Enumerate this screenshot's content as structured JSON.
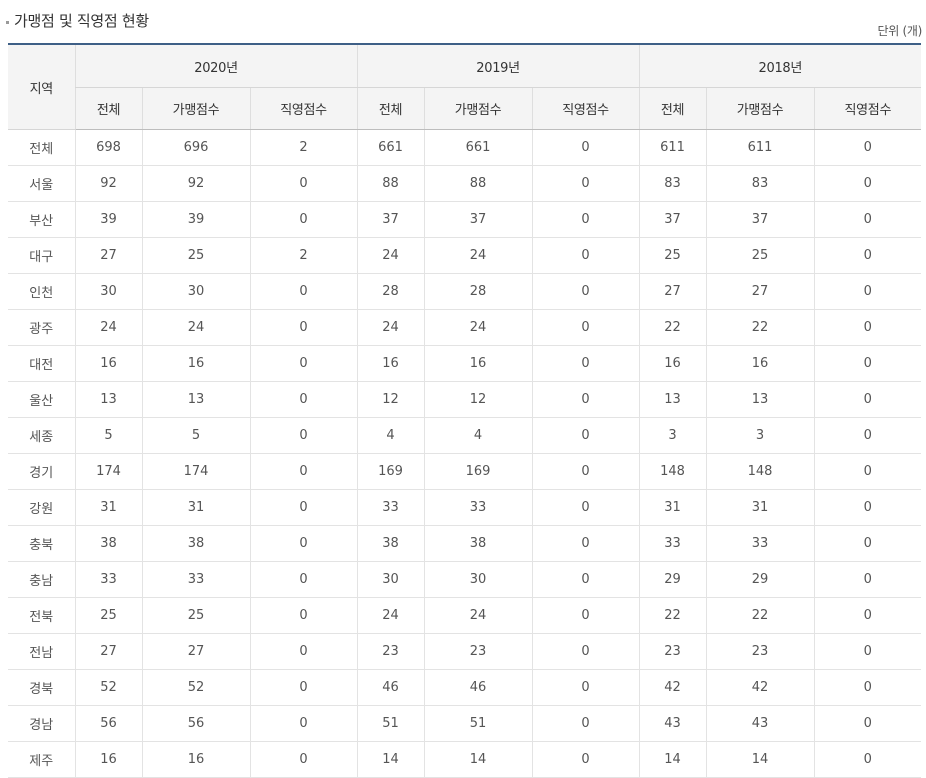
{
  "title": "가맹점 및 직영점 현황",
  "unit": "단위 (개)",
  "header": {
    "region": "지역",
    "years": [
      "2020년",
      "2019년",
      "2018년"
    ],
    "subcols": [
      "전체",
      "가맹점수",
      "직영점수"
    ]
  },
  "rows": [
    {
      "region": "전체",
      "values": [
        "698",
        "696",
        "2",
        "661",
        "661",
        "0",
        "611",
        "611",
        "0"
      ]
    },
    {
      "region": "서울",
      "values": [
        "92",
        "92",
        "0",
        "88",
        "88",
        "0",
        "83",
        "83",
        "0"
      ]
    },
    {
      "region": "부산",
      "values": [
        "39",
        "39",
        "0",
        "37",
        "37",
        "0",
        "37",
        "37",
        "0"
      ]
    },
    {
      "region": "대구",
      "values": [
        "27",
        "25",
        "2",
        "24",
        "24",
        "0",
        "25",
        "25",
        "0"
      ]
    },
    {
      "region": "인천",
      "values": [
        "30",
        "30",
        "0",
        "28",
        "28",
        "0",
        "27",
        "27",
        "0"
      ]
    },
    {
      "region": "광주",
      "values": [
        "24",
        "24",
        "0",
        "24",
        "24",
        "0",
        "22",
        "22",
        "0"
      ]
    },
    {
      "region": "대전",
      "values": [
        "16",
        "16",
        "0",
        "16",
        "16",
        "0",
        "16",
        "16",
        "0"
      ]
    },
    {
      "region": "울산",
      "values": [
        "13",
        "13",
        "0",
        "12",
        "12",
        "0",
        "13",
        "13",
        "0"
      ]
    },
    {
      "region": "세종",
      "values": [
        "5",
        "5",
        "0",
        "4",
        "4",
        "0",
        "3",
        "3",
        "0"
      ]
    },
    {
      "region": "경기",
      "values": [
        "174",
        "174",
        "0",
        "169",
        "169",
        "0",
        "148",
        "148",
        "0"
      ]
    },
    {
      "region": "강원",
      "values": [
        "31",
        "31",
        "0",
        "33",
        "33",
        "0",
        "31",
        "31",
        "0"
      ]
    },
    {
      "region": "충북",
      "values": [
        "38",
        "38",
        "0",
        "38",
        "38",
        "0",
        "33",
        "33",
        "0"
      ]
    },
    {
      "region": "충남",
      "values": [
        "33",
        "33",
        "0",
        "30",
        "30",
        "0",
        "29",
        "29",
        "0"
      ]
    },
    {
      "region": "전북",
      "values": [
        "25",
        "25",
        "0",
        "24",
        "24",
        "0",
        "22",
        "22",
        "0"
      ]
    },
    {
      "region": "전남",
      "values": [
        "27",
        "27",
        "0",
        "23",
        "23",
        "0",
        "23",
        "23",
        "0"
      ]
    },
    {
      "region": "경북",
      "values": [
        "52",
        "52",
        "0",
        "46",
        "46",
        "0",
        "42",
        "42",
        "0"
      ]
    },
    {
      "region": "경남",
      "values": [
        "56",
        "56",
        "0",
        "51",
        "51",
        "0",
        "43",
        "43",
        "0"
      ]
    },
    {
      "region": "제주",
      "values": [
        "16",
        "16",
        "0",
        "14",
        "14",
        "0",
        "14",
        "14",
        "0"
      ]
    }
  ]
}
